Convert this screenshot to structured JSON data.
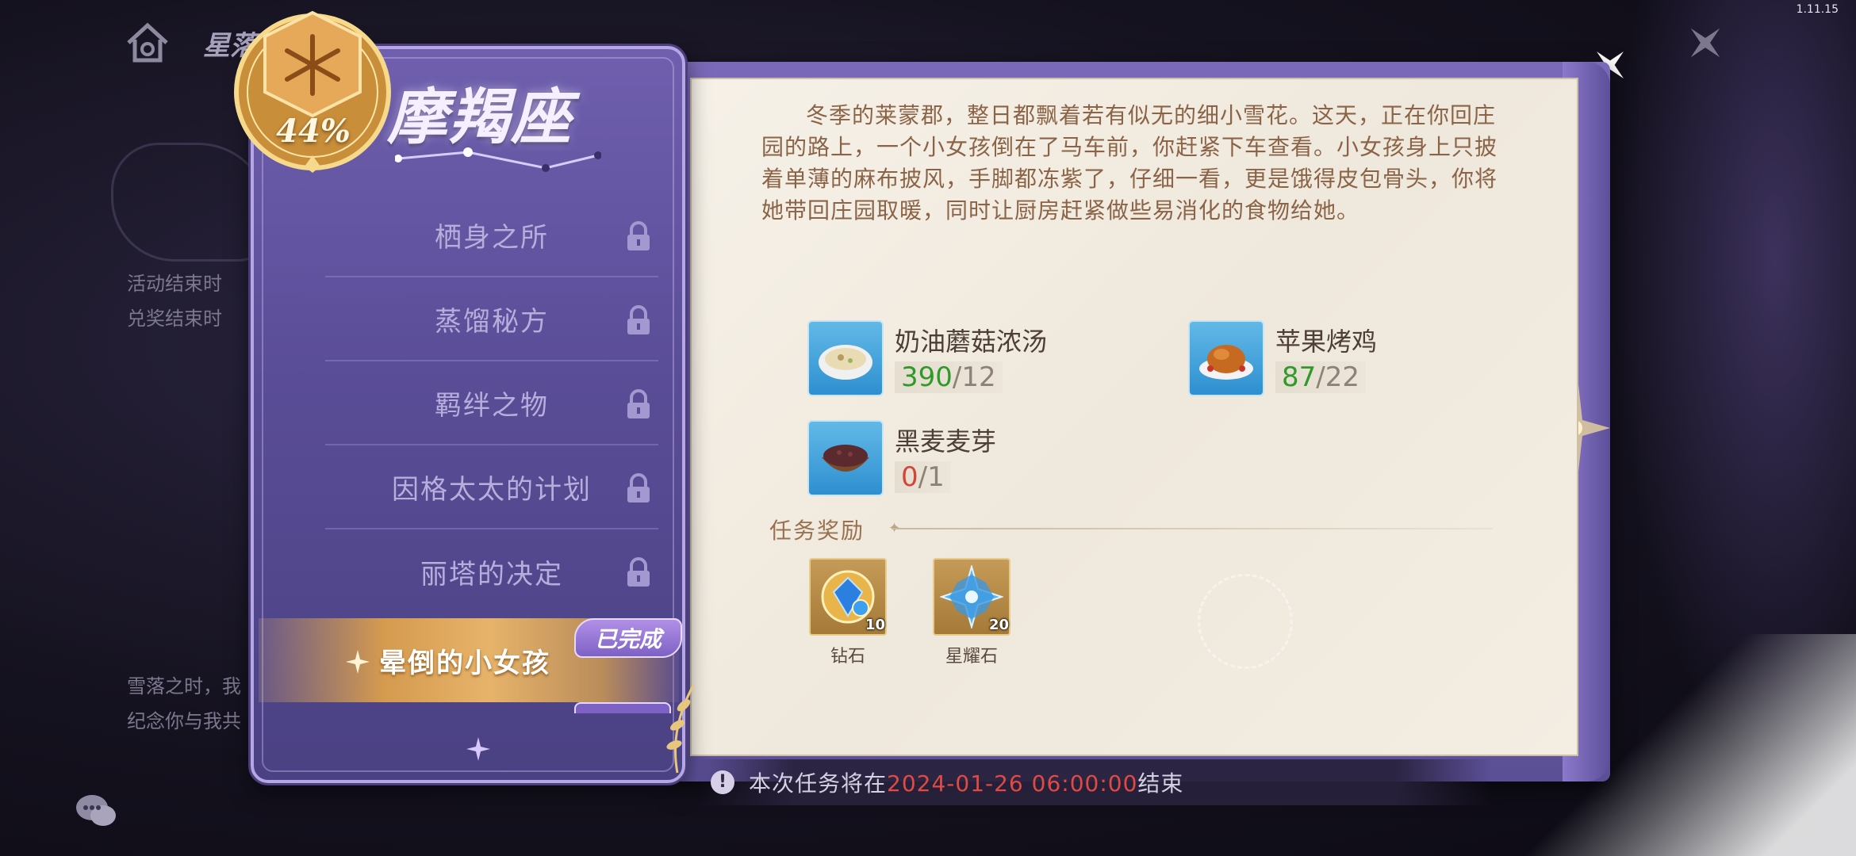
{
  "app": {
    "version": "1.11.15",
    "header_title": "星落"
  },
  "background": {
    "event_lines": [
      "活动结束时",
      "兑奖结束时"
    ],
    "story_lines": [
      "雪落之时，我",
      "纪念你与我共"
    ]
  },
  "zodiac": {
    "title": "摩羯座",
    "progress": "44%",
    "progress_value": 0.44
  },
  "menu": {
    "items": [
      {
        "label": "栖身之所",
        "locked": true
      },
      {
        "label": "蒸馏秘方",
        "locked": true
      },
      {
        "label": "羁绊之物",
        "locked": true
      },
      {
        "label": "因格太太的计划",
        "locked": true
      },
      {
        "label": "丽塔的决定",
        "locked": true
      }
    ],
    "active": {
      "label": "晕倒的小女孩",
      "badge": "已完成"
    }
  },
  "quest": {
    "story": "冬季的莱蒙郡，整日都飘着若有似无的细小雪花。这天，正在你回庄园的路上，一个小女孩倒在了马车前，你赶紧下车查看。小女孩身上只披着单薄的麻布披风，手脚都冻紫了，仔细一看，更是饿得皮包骨头，你将她带回庄园取暖，同时让厨房赶紧做些易消化的食物给她。",
    "ingredients": [
      {
        "name": "奶油蘑菇浓汤",
        "have": "390",
        "need": "/12",
        "icon": "mushroom-soup-icon"
      },
      {
        "name": "苹果烤鸡",
        "have": "87",
        "need": "/22",
        "icon": "roast-chicken-icon"
      },
      {
        "name": "黑麦麦芽",
        "have": "0",
        "need": "/1",
        "icon": "rye-malt-icon"
      }
    ],
    "rewards_title": "任务奖励",
    "rewards": [
      {
        "name": "钻石",
        "qty": "10",
        "icon": "diamond-icon"
      },
      {
        "name": "星耀石",
        "qty": "20",
        "icon": "star-stone-icon"
      }
    ]
  },
  "notice": {
    "prefix": "本次任务将在",
    "time": "2024-01-26 06:00:00",
    "suffix": "结束"
  },
  "colors": {
    "accent_gold": "#e7b36a",
    "panel_purple": "#5a4d97",
    "parchment": "#f3ede2",
    "ok_green": "#2f9a2a",
    "warn_red": "#d0463a",
    "deadline_red": "#e04a44"
  }
}
